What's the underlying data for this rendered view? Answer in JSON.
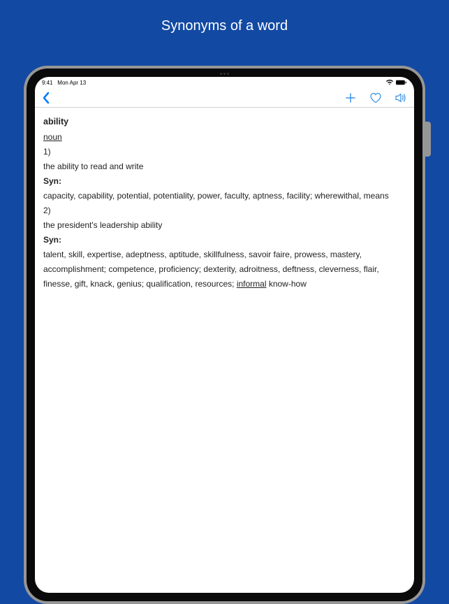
{
  "page": {
    "title": "Synonyms of a word"
  },
  "statusBar": {
    "time": "9:41",
    "date": "Mon Apr 13"
  },
  "entry": {
    "headword": "ability",
    "partOfSpeech": "noun",
    "senses": [
      {
        "num": "1)",
        "example": "the ability to read and write",
        "synLabel": "Syn:",
        "synonyms": "capacity, capability, potential, potentiality, power, faculty, aptness, facility; wherewithal, means"
      },
      {
        "num": "2)",
        "example": "the president's leadership ability",
        "synLabel": "Syn:",
        "synonymsBefore": "talent, skill, expertise, adeptness, aptitude, skillfulness, savoir faire, prowess, mastery, accomplishment; competence, proficiency; dexterity, adroitness, deftness, cleverness, flair, finesse, gift, knack, genius; qualification, resources; ",
        "registerLabel": "informal",
        "synonymsAfter": " know-how"
      }
    ]
  }
}
